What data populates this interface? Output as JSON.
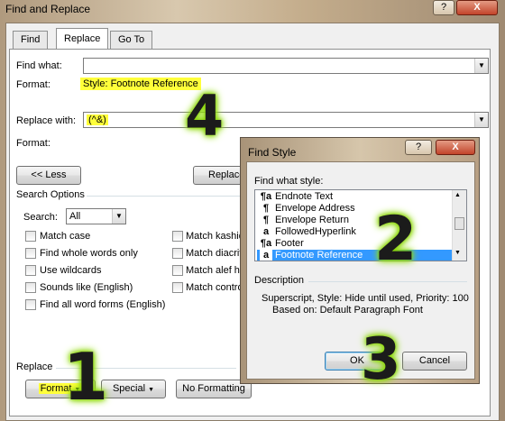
{
  "window": {
    "title": "Find and Replace",
    "help_label": "?",
    "close_label": "X"
  },
  "tabs": [
    {
      "label": "Find",
      "key": "d"
    },
    {
      "label": "Replace",
      "key": "p"
    },
    {
      "label": "Go To",
      "key": "G"
    }
  ],
  "find": {
    "label": "Find what:",
    "value": "",
    "format_label": "Format:",
    "format_value": "Style: Footnote Reference"
  },
  "replace": {
    "label": "Replace with:",
    "value": "(^&)",
    "format_label": "Format:"
  },
  "buttons": {
    "less": "<< Less",
    "replace": "Replace"
  },
  "search_options": {
    "heading": "Search Options",
    "search_label": "Search:",
    "search_value": "All",
    "left": [
      {
        "label": "Match case",
        "checked": false
      },
      {
        "label": "Find whole words only",
        "checked": false
      },
      {
        "label": "Use wildcards",
        "checked": false
      },
      {
        "label": "Sounds like (English)",
        "checked": false
      },
      {
        "label": "Find all word forms (English)",
        "checked": false
      }
    ],
    "right": [
      {
        "label": "Match kashid",
        "checked": false
      },
      {
        "label": "Match diacrit",
        "checked": false
      },
      {
        "label": "Match alef ha",
        "checked": false
      },
      {
        "label": "Match contro",
        "checked": false
      }
    ]
  },
  "replace_section": {
    "heading": "Replace",
    "format_btn": "Format",
    "special_btn": "Special",
    "noformat_btn": "No Formatting"
  },
  "find_style": {
    "title": "Find Style",
    "help_label": "?",
    "close_label": "X",
    "list_label": "Find what style:",
    "items": [
      {
        "icon": "¶a",
        "label": "Endnote Text",
        "selected": false
      },
      {
        "icon": "¶",
        "label": "Envelope Address",
        "selected": false
      },
      {
        "icon": "¶",
        "label": "Envelope Return",
        "selected": false
      },
      {
        "icon": "a",
        "label": "FollowedHyperlink",
        "selected": false
      },
      {
        "icon": "¶a",
        "label": "Footer",
        "selected": false
      },
      {
        "icon": "a",
        "label": "Footnote Reference",
        "selected": true
      }
    ],
    "description_heading": "Description",
    "description_line1": "Superscript, Style: Hide until used, Priority: 100",
    "description_line2": "Based on: Default Paragraph Font",
    "ok_label": "OK",
    "cancel_label": "Cancel"
  },
  "annotations": {
    "n1": "1",
    "n2": "2",
    "n3": "3",
    "n4": "4"
  },
  "colors": {
    "highlight": "#ffff3a",
    "selection": "#3399ff",
    "annotation_glow": "#8bd60a"
  }
}
